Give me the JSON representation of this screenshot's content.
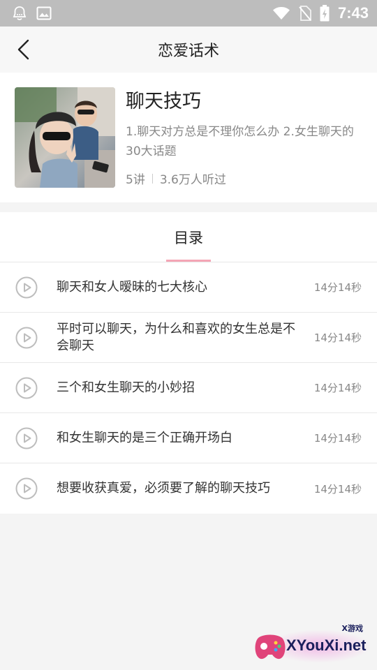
{
  "status_bar": {
    "time": "7:43"
  },
  "header": {
    "title": "恋爱话术"
  },
  "course": {
    "title": "聊天技巧",
    "description": "1.聊天对方总是不理你怎么办 2.女生聊天的30大话题",
    "lessons": "5讲",
    "listeners": "3.6万人听过"
  },
  "catalog": {
    "tab_label": "目录",
    "accent_color": "#f4a5b5",
    "episodes": [
      {
        "title": "聊天和女人暧昧的七大核心",
        "duration": "14分14秒"
      },
      {
        "title": "平时可以聊天，为什么和喜欢的女生总是不会聊天",
        "duration": "14分14秒"
      },
      {
        "title": "三个和女生聊天的小妙招",
        "duration": "14分14秒"
      },
      {
        "title": "和女生聊天的是三个正确开场白",
        "duration": "14分14秒"
      },
      {
        "title": "想要收获真爱，必须要了解的聊天技巧",
        "duration": "14分14秒"
      }
    ]
  },
  "watermark": {
    "text": "XYouXi.net",
    "sub": "X游戏"
  }
}
